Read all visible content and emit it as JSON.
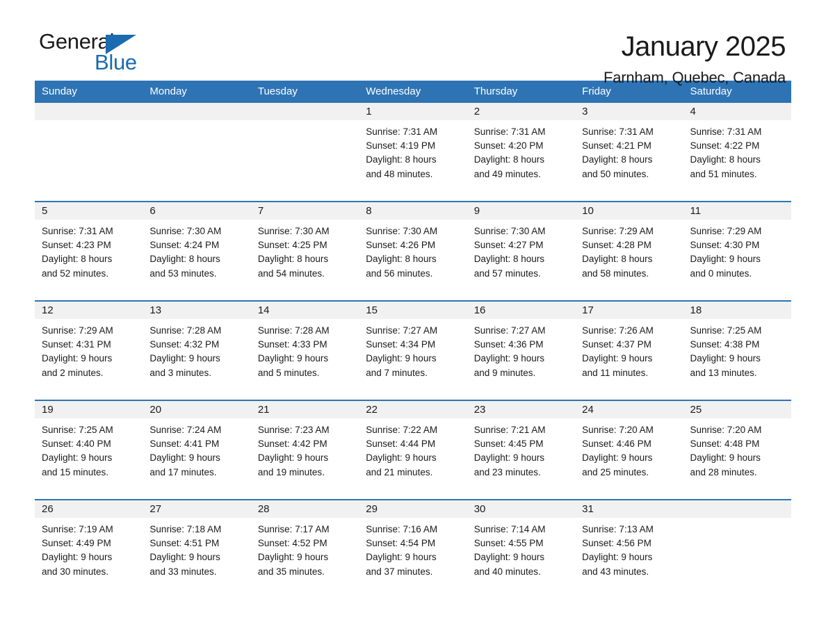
{
  "logo": {
    "word_one": "General",
    "word_two": "Blue",
    "triangle_color": "#1a6bb0"
  },
  "header": {
    "title": "January 2025",
    "location": "Farnham, Quebec, Canada"
  },
  "theme": {
    "header_blue": "#2e74b5",
    "band_gray": "#f1f1f1",
    "text": "#1a1a1a"
  },
  "weekday_headers": [
    "Sunday",
    "Monday",
    "Tuesday",
    "Wednesday",
    "Thursday",
    "Friday",
    "Saturday"
  ],
  "weeks": [
    [
      {
        "day": "",
        "lines": []
      },
      {
        "day": "",
        "lines": []
      },
      {
        "day": "",
        "lines": []
      },
      {
        "day": "1",
        "lines": [
          "Sunrise: 7:31 AM",
          "Sunset: 4:19 PM",
          "Daylight: 8 hours",
          "and 48 minutes."
        ]
      },
      {
        "day": "2",
        "lines": [
          "Sunrise: 7:31 AM",
          "Sunset: 4:20 PM",
          "Daylight: 8 hours",
          "and 49 minutes."
        ]
      },
      {
        "day": "3",
        "lines": [
          "Sunrise: 7:31 AM",
          "Sunset: 4:21 PM",
          "Daylight: 8 hours",
          "and 50 minutes."
        ]
      },
      {
        "day": "4",
        "lines": [
          "Sunrise: 7:31 AM",
          "Sunset: 4:22 PM",
          "Daylight: 8 hours",
          "and 51 minutes."
        ]
      }
    ],
    [
      {
        "day": "5",
        "lines": [
          "Sunrise: 7:31 AM",
          "Sunset: 4:23 PM",
          "Daylight: 8 hours",
          "and 52 minutes."
        ]
      },
      {
        "day": "6",
        "lines": [
          "Sunrise: 7:30 AM",
          "Sunset: 4:24 PM",
          "Daylight: 8 hours",
          "and 53 minutes."
        ]
      },
      {
        "day": "7",
        "lines": [
          "Sunrise: 7:30 AM",
          "Sunset: 4:25 PM",
          "Daylight: 8 hours",
          "and 54 minutes."
        ]
      },
      {
        "day": "8",
        "lines": [
          "Sunrise: 7:30 AM",
          "Sunset: 4:26 PM",
          "Daylight: 8 hours",
          "and 56 minutes."
        ]
      },
      {
        "day": "9",
        "lines": [
          "Sunrise: 7:30 AM",
          "Sunset: 4:27 PM",
          "Daylight: 8 hours",
          "and 57 minutes."
        ]
      },
      {
        "day": "10",
        "lines": [
          "Sunrise: 7:29 AM",
          "Sunset: 4:28 PM",
          "Daylight: 8 hours",
          "and 58 minutes."
        ]
      },
      {
        "day": "11",
        "lines": [
          "Sunrise: 7:29 AM",
          "Sunset: 4:30 PM",
          "Daylight: 9 hours",
          "and 0 minutes."
        ]
      }
    ],
    [
      {
        "day": "12",
        "lines": [
          "Sunrise: 7:29 AM",
          "Sunset: 4:31 PM",
          "Daylight: 9 hours",
          "and 2 minutes."
        ]
      },
      {
        "day": "13",
        "lines": [
          "Sunrise: 7:28 AM",
          "Sunset: 4:32 PM",
          "Daylight: 9 hours",
          "and 3 minutes."
        ]
      },
      {
        "day": "14",
        "lines": [
          "Sunrise: 7:28 AM",
          "Sunset: 4:33 PM",
          "Daylight: 9 hours",
          "and 5 minutes."
        ]
      },
      {
        "day": "15",
        "lines": [
          "Sunrise: 7:27 AM",
          "Sunset: 4:34 PM",
          "Daylight: 9 hours",
          "and 7 minutes."
        ]
      },
      {
        "day": "16",
        "lines": [
          "Sunrise: 7:27 AM",
          "Sunset: 4:36 PM",
          "Daylight: 9 hours",
          "and 9 minutes."
        ]
      },
      {
        "day": "17",
        "lines": [
          "Sunrise: 7:26 AM",
          "Sunset: 4:37 PM",
          "Daylight: 9 hours",
          "and 11 minutes."
        ]
      },
      {
        "day": "18",
        "lines": [
          "Sunrise: 7:25 AM",
          "Sunset: 4:38 PM",
          "Daylight: 9 hours",
          "and 13 minutes."
        ]
      }
    ],
    [
      {
        "day": "19",
        "lines": [
          "Sunrise: 7:25 AM",
          "Sunset: 4:40 PM",
          "Daylight: 9 hours",
          "and 15 minutes."
        ]
      },
      {
        "day": "20",
        "lines": [
          "Sunrise: 7:24 AM",
          "Sunset: 4:41 PM",
          "Daylight: 9 hours",
          "and 17 minutes."
        ]
      },
      {
        "day": "21",
        "lines": [
          "Sunrise: 7:23 AM",
          "Sunset: 4:42 PM",
          "Daylight: 9 hours",
          "and 19 minutes."
        ]
      },
      {
        "day": "22",
        "lines": [
          "Sunrise: 7:22 AM",
          "Sunset: 4:44 PM",
          "Daylight: 9 hours",
          "and 21 minutes."
        ]
      },
      {
        "day": "23",
        "lines": [
          "Sunrise: 7:21 AM",
          "Sunset: 4:45 PM",
          "Daylight: 9 hours",
          "and 23 minutes."
        ]
      },
      {
        "day": "24",
        "lines": [
          "Sunrise: 7:20 AM",
          "Sunset: 4:46 PM",
          "Daylight: 9 hours",
          "and 25 minutes."
        ]
      },
      {
        "day": "25",
        "lines": [
          "Sunrise: 7:20 AM",
          "Sunset: 4:48 PM",
          "Daylight: 9 hours",
          "and 28 minutes."
        ]
      }
    ],
    [
      {
        "day": "26",
        "lines": [
          "Sunrise: 7:19 AM",
          "Sunset: 4:49 PM",
          "Daylight: 9 hours",
          "and 30 minutes."
        ]
      },
      {
        "day": "27",
        "lines": [
          "Sunrise: 7:18 AM",
          "Sunset: 4:51 PM",
          "Daylight: 9 hours",
          "and 33 minutes."
        ]
      },
      {
        "day": "28",
        "lines": [
          "Sunrise: 7:17 AM",
          "Sunset: 4:52 PM",
          "Daylight: 9 hours",
          "and 35 minutes."
        ]
      },
      {
        "day": "29",
        "lines": [
          "Sunrise: 7:16 AM",
          "Sunset: 4:54 PM",
          "Daylight: 9 hours",
          "and 37 minutes."
        ]
      },
      {
        "day": "30",
        "lines": [
          "Sunrise: 7:14 AM",
          "Sunset: 4:55 PM",
          "Daylight: 9 hours",
          "and 40 minutes."
        ]
      },
      {
        "day": "31",
        "lines": [
          "Sunrise: 7:13 AM",
          "Sunset: 4:56 PM",
          "Daylight: 9 hours",
          "and 43 minutes."
        ]
      },
      {
        "day": "",
        "lines": []
      }
    ]
  ]
}
